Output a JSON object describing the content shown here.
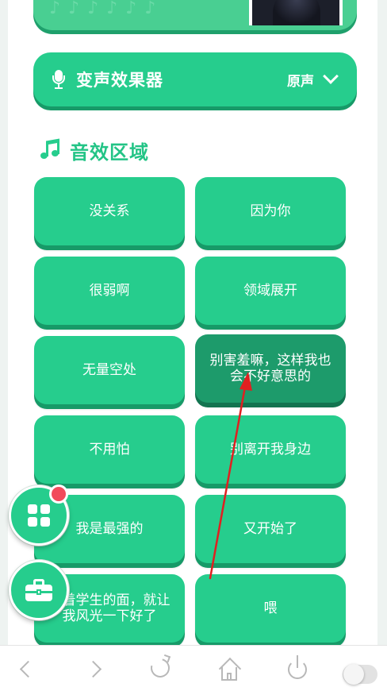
{
  "voice_changer": {
    "title": "变声效果器",
    "value": "原声"
  },
  "section": {
    "title": "音效区域"
  },
  "sound_buttons": [
    {
      "label": "没关系"
    },
    {
      "label": "因为你"
    },
    {
      "label": "很弱啊"
    },
    {
      "label": "领域展开"
    },
    {
      "label": "无量空处"
    },
    {
      "label": "别害羞嘛，这样我也会不好意思的"
    },
    {
      "label": "不用怕"
    },
    {
      "label": "别离开我身边"
    },
    {
      "label": "我是最强的"
    },
    {
      "label": "又开始了"
    },
    {
      "label": "当着学生的面，就让我风光一下好了"
    },
    {
      "label": "喂"
    }
  ],
  "active_button_index": 5,
  "colors": {
    "accent": "#26cd8d",
    "accent_dark": "#179a68",
    "active": "#1d9b6b",
    "badge": "#f24a5c",
    "annotation_arrow": "#e02020"
  },
  "icons": {
    "voice_bar": "microphone-icon",
    "section": "music-note-icon",
    "fab_grid": "grid-icon",
    "fab_tools": "toolbox-icon",
    "nav": [
      "back-icon",
      "forward-icon",
      "refresh-icon",
      "home-icon",
      "power-icon",
      "toggle-switch"
    ]
  }
}
